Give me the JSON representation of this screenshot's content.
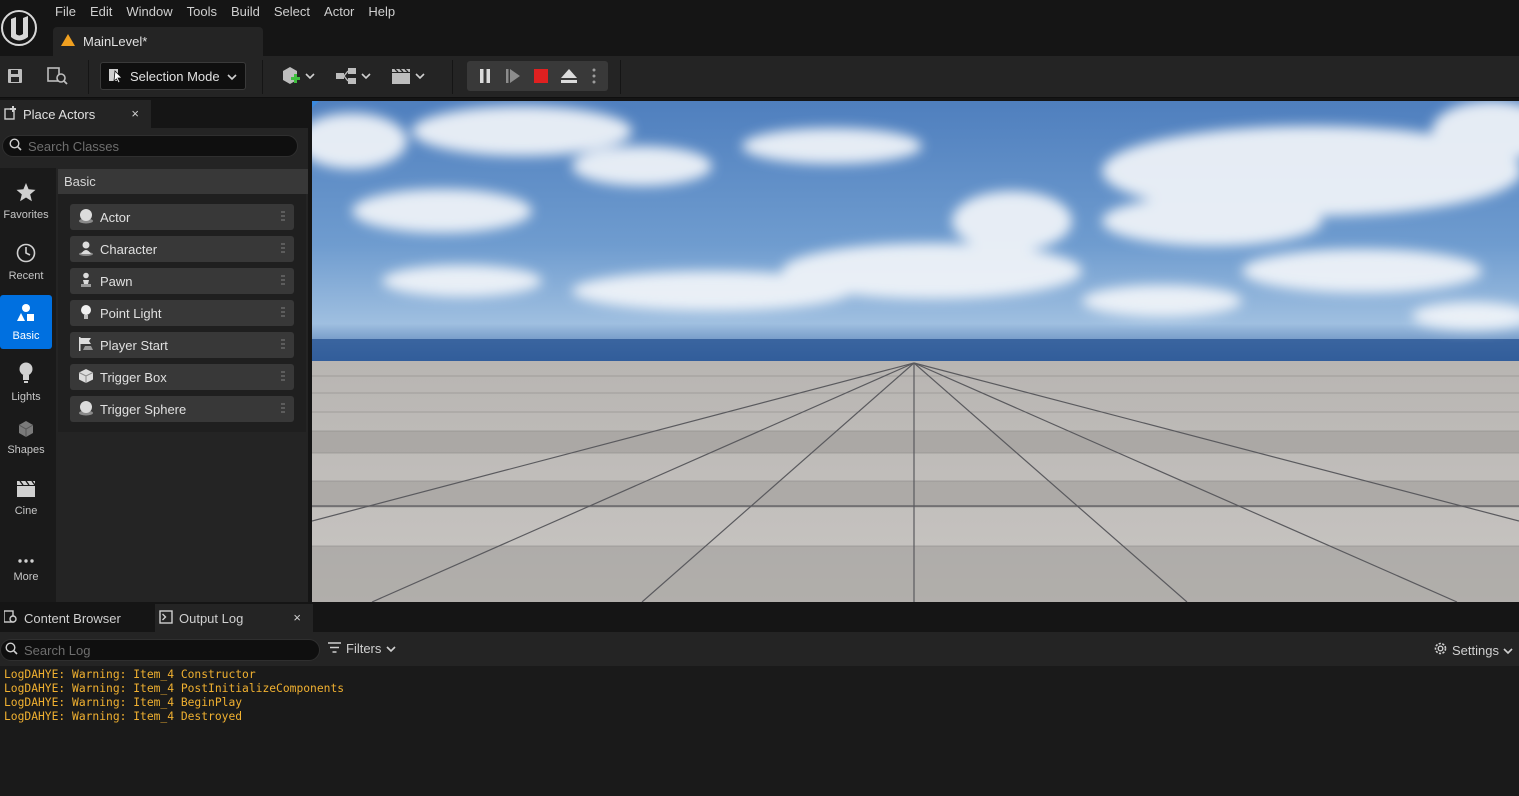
{
  "menu": [
    "File",
    "Edit",
    "Window",
    "Tools",
    "Build",
    "Select",
    "Actor",
    "Help"
  ],
  "level_tab": {
    "label": "MainLevel*"
  },
  "toolbar": {
    "mode_label": "Selection Mode"
  },
  "place_actors": {
    "tab_label": "Place Actors",
    "close_label": "×",
    "search_placeholder": "Search Classes",
    "categories": [
      {
        "label": "Favorites",
        "icon": "star-icon"
      },
      {
        "label": "Recent",
        "icon": "clock-icon"
      },
      {
        "label": "Basic",
        "icon": "basic-shapes-icon",
        "active": true
      },
      {
        "label": "Lights",
        "icon": "bulb-icon"
      },
      {
        "label": "Shapes",
        "icon": "cube-icon"
      },
      {
        "label": "Cine",
        "icon": "clapper-icon"
      },
      {
        "label": "More",
        "icon": "more-dots-icon"
      }
    ],
    "section_header": "Basic",
    "items": [
      {
        "label": "Actor",
        "icon": "sphere-icon"
      },
      {
        "label": "Character",
        "icon": "character-icon"
      },
      {
        "label": "Pawn",
        "icon": "pawn-icon"
      },
      {
        "label": "Point Light",
        "icon": "bulb-icon"
      },
      {
        "label": "Player Start",
        "icon": "flag-icon"
      },
      {
        "label": "Trigger Box",
        "icon": "box-icon"
      },
      {
        "label": "Trigger Sphere",
        "icon": "sphere-icon"
      }
    ]
  },
  "bottom_tabs": {
    "content_browser": "Content Browser",
    "output_log": "Output Log",
    "close_label": "×"
  },
  "output_log": {
    "search_placeholder": "Search Log",
    "filters_label": "Filters",
    "settings_label": "Settings",
    "lines": [
      "LogDAHYE: Warning: Item_4 Constructor",
      "LogDAHYE: Warning: Item_4 PostInitializeComponents",
      "LogDAHYE: Warning: Item_4 BeginPlay",
      "LogDAHYE: Warning: Item_4 Destroyed"
    ],
    "warning_color": "#f0b030"
  },
  "colors": {
    "accent": "#0070e0",
    "stop_red": "#e02020",
    "panel": "#242424"
  }
}
